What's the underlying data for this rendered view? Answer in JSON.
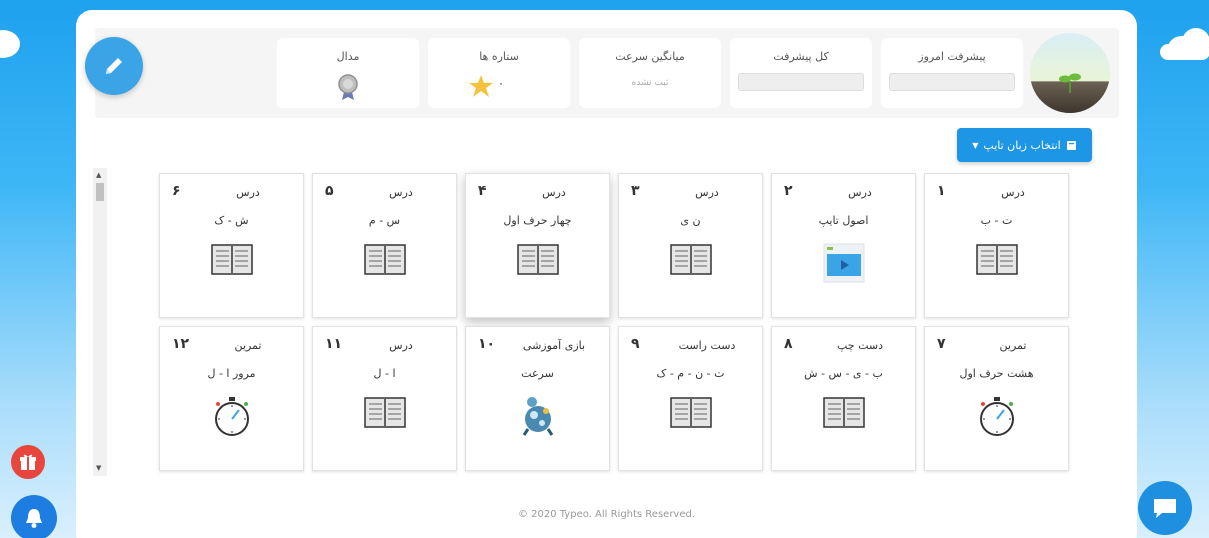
{
  "stats": {
    "today_progress": "پیشرفت امروز",
    "total_progress": "کل پیشرفت",
    "avg_speed": "میانگین سرعت",
    "avg_speed_value": "ثبت نشده",
    "stars": "ستاره ها",
    "stars_value": "۰",
    "medal": "مدال"
  },
  "lang_button": "انتخاب زبان تایپ",
  "lessons": [
    {
      "type": "درس",
      "num": "۱",
      "title": "ت - ب",
      "icon": "book-icon"
    },
    {
      "type": "درس",
      "num": "۲",
      "title": "اصول تایپ",
      "icon": "video-icon"
    },
    {
      "type": "درس",
      "num": "۳",
      "title": "ن ی",
      "icon": "book-icon"
    },
    {
      "type": "درس",
      "num": "۴",
      "title": "چهار حرف اول",
      "icon": "book-icon"
    },
    {
      "type": "درس",
      "num": "۵",
      "title": "س - م",
      "icon": "book-icon"
    },
    {
      "type": "درس",
      "num": "۶",
      "title": "ش - ک",
      "icon": "book-icon"
    },
    {
      "type": "تمرین",
      "num": "۷",
      "title": "هشت حرف اول",
      "icon": "stopwatch-icon"
    },
    {
      "type": "دست چپ",
      "num": "۸",
      "title": "ب - ی - س - ش",
      "icon": "book-icon"
    },
    {
      "type": "دست راست",
      "num": "۹",
      "title": "ت - ن - م - ک",
      "icon": "book-icon"
    },
    {
      "type": "بازی آموزشی",
      "num": "۱۰",
      "title": "سرعت",
      "icon": "game-icon"
    },
    {
      "type": "درس",
      "num": "۱۱",
      "title": "ا - ل",
      "icon": "book-icon"
    },
    {
      "type": "تمرین",
      "num": "۱۲",
      "title": "مرور ا - ل",
      "icon": "stopwatch-icon"
    }
  ],
  "footer": "© 2020 Typeo. All Rights Reserved.",
  "colors": {
    "accent": "#1e96e6",
    "gift": "#e8453c",
    "star": "#f5c33b"
  }
}
